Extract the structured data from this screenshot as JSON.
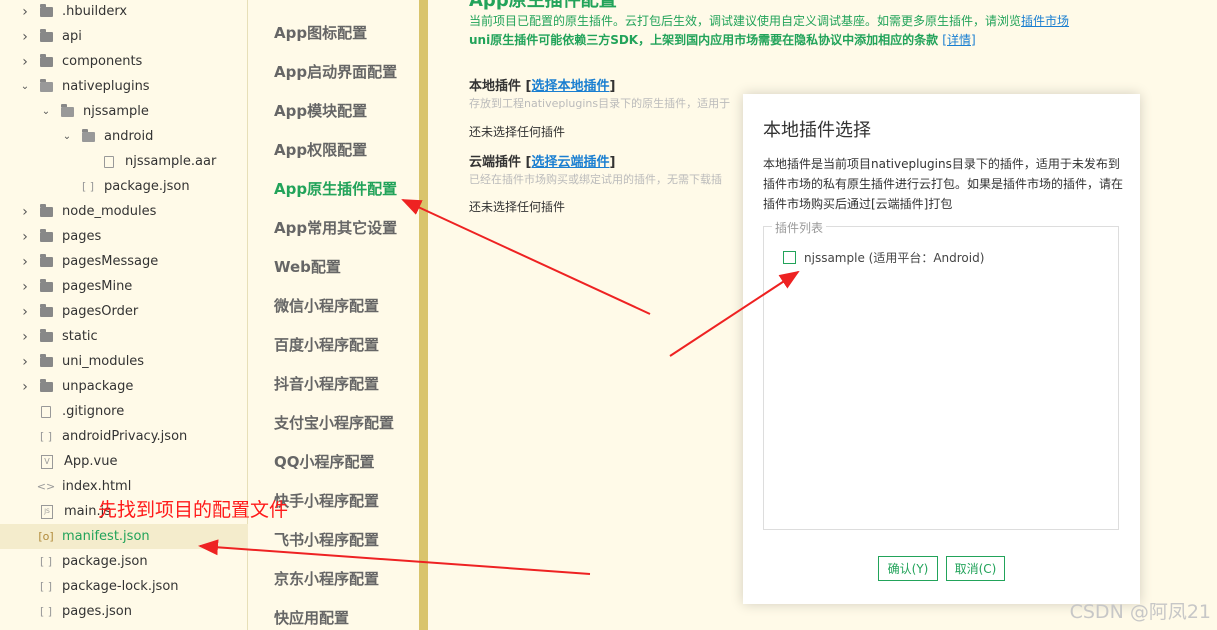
{
  "tree": {
    "items": [
      {
        "label": ".hbuilderx",
        "type": "folder",
        "expanded": false
      },
      {
        "label": "api",
        "type": "folder",
        "expanded": false
      },
      {
        "label": "components",
        "type": "folder",
        "expanded": false
      },
      {
        "label": "nativeplugins",
        "type": "folder",
        "expanded": true
      },
      {
        "label": "njssample",
        "type": "folder",
        "expanded": true
      },
      {
        "label": "android",
        "type": "folder",
        "expanded": true
      },
      {
        "label": "njssample.aar",
        "type": "file"
      },
      {
        "label": "package.json",
        "type": "json"
      },
      {
        "label": "node_modules",
        "type": "folder",
        "expanded": false
      },
      {
        "label": "pages",
        "type": "folder",
        "expanded": false
      },
      {
        "label": "pagesMessage",
        "type": "folder",
        "expanded": false
      },
      {
        "label": "pagesMine",
        "type": "folder",
        "expanded": false
      },
      {
        "label": "pagesOrder",
        "type": "folder",
        "expanded": false
      },
      {
        "label": "static",
        "type": "folder",
        "expanded": false
      },
      {
        "label": "uni_modules",
        "type": "folder",
        "expanded": false
      },
      {
        "label": "unpackage",
        "type": "folder",
        "expanded": false
      },
      {
        "label": ".gitignore",
        "type": "file"
      },
      {
        "label": "androidPrivacy.json",
        "type": "json"
      },
      {
        "label": "App.vue",
        "type": "vue"
      },
      {
        "label": "index.html",
        "type": "html"
      },
      {
        "label": "main.js",
        "type": "js"
      },
      {
        "label": "manifest.json",
        "type": "manifest",
        "selected": true
      },
      {
        "label": "package.json",
        "type": "json"
      },
      {
        "label": "package-lock.json",
        "type": "json"
      },
      {
        "label": "pages.json",
        "type": "json"
      }
    ]
  },
  "nav": {
    "items": [
      {
        "label": "App图标配置"
      },
      {
        "label": "App启动界面配置"
      },
      {
        "label": "App模块配置"
      },
      {
        "label": "App权限配置"
      },
      {
        "label": "App原生插件配置",
        "active": true
      },
      {
        "label": "App常用其它设置"
      },
      {
        "label": "Web配置"
      },
      {
        "label": "微信小程序配置"
      },
      {
        "label": "百度小程序配置"
      },
      {
        "label": "抖音小程序配置"
      },
      {
        "label": "支付宝小程序配置"
      },
      {
        "label": "QQ小程序配置"
      },
      {
        "label": "快手小程序配置"
      },
      {
        "label": "飞书小程序配置"
      },
      {
        "label": "京东小程序配置"
      },
      {
        "label": "快应用配置"
      }
    ]
  },
  "main": {
    "title": "App原生插件配置",
    "info_line1": "当前项目已配置的原生插件。云打包后生效，调试建议使用自定义调试基座。如需更多原生插件，请浏览",
    "info_link1": "插件市场",
    "info_line2": "uni原生插件可能依赖三方SDK，上架到国内应用市场需要在隐私协议中添加相应的条款",
    "info_link2": "[详情]",
    "local": {
      "title": "本地插件",
      "link": "选择本地插件",
      "desc": "存放到工程nativeplugins目录下的原生插件，适用于",
      "empty": "还未选择任何插件"
    },
    "cloud": {
      "title": "云端插件",
      "link": "选择云端插件",
      "desc": "已经在插件市场购买或绑定试用的插件，无需下载插",
      "empty": "还未选择任何插件"
    }
  },
  "dialog": {
    "title": "本地插件选择",
    "description": "本地插件是当前项目nativeplugins目录下的插件，适用于未发布到插件市场的私有原生插件进行云打包。如果是插件市场的插件，请在插件市场购买后通过[云端插件]打包",
    "legend": "插件列表",
    "plugins": [
      {
        "label": "njssample (适用平台：Android)",
        "checked": false
      }
    ],
    "ok_label": "确认(Y)",
    "cancel_label": "取消(C)"
  },
  "annotation": {
    "text": "先找到项目的配置文件",
    "color": "#ff1a1a"
  },
  "watermark": "CSDN @阿凤21",
  "colors": {
    "accent": "#22a35a",
    "link": "#1a7fd1",
    "background": "#fffae8",
    "divider": "#d9c46c"
  }
}
